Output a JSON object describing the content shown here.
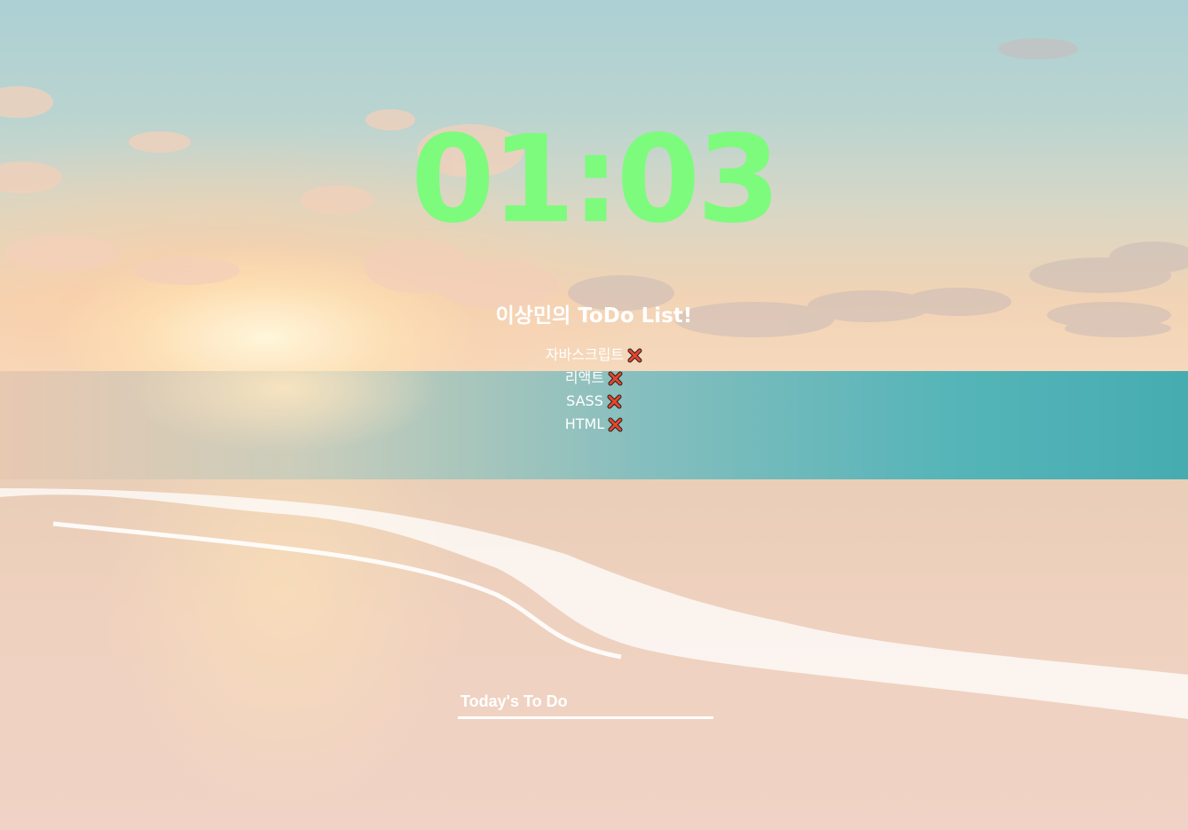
{
  "background": {
    "scene": "beach-sunset-photo",
    "colors": {
      "sky_top": "#a9cfd3",
      "sunset": "#f6d8bb",
      "sea": "#3fa9ad",
      "sand": "#efd0bd"
    }
  },
  "clock": {
    "time": "01:03",
    "color": "#7dfb7d"
  },
  "todo": {
    "title": "이상민의 ToDo List!",
    "items": [
      {
        "text": "자바스크립트",
        "delete_icon": "close-x-icon"
      },
      {
        "text": "리액트",
        "delete_icon": "close-x-icon"
      },
      {
        "text": "SASS",
        "delete_icon": "close-x-icon"
      },
      {
        "text": "HTML",
        "delete_icon": "close-x-icon"
      }
    ],
    "delete_icon_colors": {
      "fill": "#e8452c",
      "outline": "#222222"
    }
  },
  "form": {
    "placeholder": "Today's To Do",
    "value": ""
  }
}
